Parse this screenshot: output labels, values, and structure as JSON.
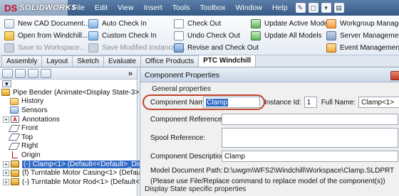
{
  "app": {
    "logo_text": "SOLIDWORKS",
    "logo_mark": "DS",
    "menu": [
      "File",
      "Edit",
      "View",
      "Insert",
      "Tools",
      "Toolbox",
      "Window",
      "Help"
    ]
  },
  "ribbon": {
    "col1": [
      "New CAD Document...",
      "Open from Windchill...",
      "Save to Workspace..."
    ],
    "col2": [
      "Auto Check In",
      "Custom Check In",
      "Save Modified Instances..."
    ],
    "col3": [
      "Check Out",
      "Undo Check Out",
      "Revise and Check Out"
    ],
    "col4": [
      "Update Active Model",
      "Update All Models"
    ],
    "col5": [
      "Workgroup Manager...",
      "Server Management...",
      "Event Management..."
    ]
  },
  "tabs": [
    "Assembly",
    "Layout",
    "Sketch",
    "Evaluate",
    "Office Products",
    "PTC Windchill"
  ],
  "active_tab": "PTC Windchill",
  "tree": {
    "collapse_arrow": "»",
    "filter_glyph": "▼",
    "root": "Pipe Bender  (Animate<Display State-3>)",
    "items": [
      {
        "label": "History",
        "type": "folder",
        "indent": 1
      },
      {
        "label": "Sensors",
        "type": "sensor",
        "indent": 1
      },
      {
        "label": "Annotations",
        "type": "annotation",
        "indent": 1,
        "expand": "+"
      },
      {
        "label": "Front",
        "type": "plane",
        "indent": 1
      },
      {
        "label": "Top",
        "type": "plane",
        "indent": 1
      },
      {
        "label": "Right",
        "type": "plane",
        "indent": 1
      },
      {
        "label": "Origin",
        "type": "origin",
        "indent": 1
      },
      {
        "label": "(-) Clamp<1> (Default<<Default>_Disp",
        "type": "part",
        "indent": 1,
        "expand": "+",
        "selected": true
      },
      {
        "label": "(f) Turntable Motor Casing<1> (Default",
        "type": "part",
        "indent": 1,
        "expand": "+"
      },
      {
        "label": "(-) Turntable Motor Rod<1> (Default<<",
        "type": "part",
        "indent": 1,
        "expand": "+"
      }
    ]
  },
  "dialog": {
    "title": "Component Properties",
    "group_caption": "General properties",
    "component_name_label": "Component Name:",
    "component_name_value": "Clamp",
    "instance_id_label": "Instance Id:",
    "instance_id_value": "1",
    "full_name_label": "Full Name:",
    "full_name_value": "Clamp<1>",
    "component_reference_label": "Component Reference:",
    "spool_reference_label": "Spool Reference:",
    "component_description_label": "Component Description:",
    "component_description_value": "Clamp",
    "model_document_path_label": "Model Document Path:",
    "model_document_path_value": "D:\\uwgm\\WFS2\\Windchill\\Workspace\\Clamp.SLDPRT",
    "note": "(Please use File/Replace command to replace model of the component(s))",
    "display_state_caption": "Display State specific properties"
  },
  "colors": {
    "highlight_oval": "#c0432f",
    "selection": "#316ac5",
    "titlebar": "#355a86"
  }
}
